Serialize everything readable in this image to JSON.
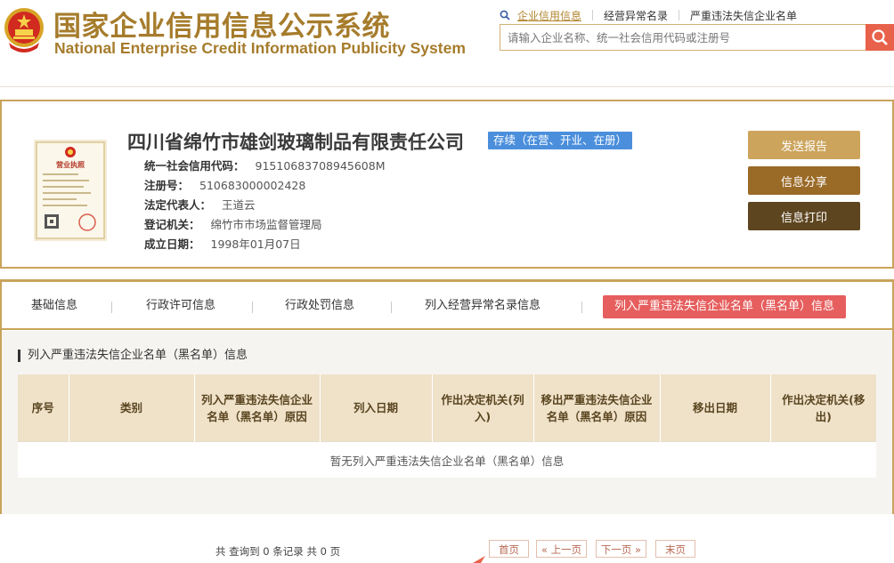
{
  "header": {
    "logo_cn": "国家企业信用信息公示系统",
    "logo_en": "National Enterprise Credit Information Publicity System",
    "emblem_icon": "national-emblem-icon",
    "nav": [
      {
        "label": "企业信用信息",
        "active": true
      },
      {
        "label": "经营异常名录",
        "active": false
      },
      {
        "label": "严重违法失信企业名单",
        "active": false
      }
    ],
    "search": {
      "placeholder": "请输入企业名称、统一社会信用代码或注册号",
      "value": "",
      "button_icon": "search-icon"
    }
  },
  "company": {
    "name": "四川省绵竹市雄剑玻璃制品有限责任公司",
    "status": "存续（在营、开业、在册）",
    "license_icon": "business-license-icon",
    "license_title": "营业执照",
    "fields": [
      {
        "key": "统一社会信用代码：",
        "value": "91510683708945608M"
      },
      {
        "key": "注册号：",
        "value": "510683000002428"
      },
      {
        "key": "法定代表人：",
        "value": "王道云"
      },
      {
        "key": "登记机关：",
        "value": "绵竹市市场监督管理局"
      },
      {
        "key": "成立日期：",
        "value": "1998年01月07日"
      }
    ],
    "actions": {
      "send_report": "发送报告",
      "share": "信息分享",
      "print": "信息打印"
    }
  },
  "tabs": [
    {
      "label": "基础信息",
      "active": false
    },
    {
      "label": "行政许可信息",
      "active": false
    },
    {
      "label": "行政处罚信息",
      "active": false
    },
    {
      "label": "列入经营异常名录信息",
      "active": false
    },
    {
      "label": "列入严重违法失信企业名单（黑名单）信息",
      "active": true
    }
  ],
  "blacklist": {
    "section_title": "列入严重违法失信企业名单（黑名单）信息",
    "columns": [
      "序号",
      "类别",
      "列入严重违法失信企业名单（黑名单）原因",
      "列入日期",
      "作出决定机关(列入)",
      "移出严重违法失信企业名单（黑名单）原因",
      "移出日期",
      "作出决定机关(移出)"
    ],
    "empty_message": "暂无列入严重违法失信企业名单（黑名单）信息",
    "pager": {
      "summary": "共 查询到 0 条记录 共 0 页",
      "first": "首页",
      "prev": "« 上一页",
      "next": "下一页 »",
      "last": "末页"
    }
  },
  "colors": {
    "gold": "#c9a35b",
    "title_gold": "#a67c2c",
    "status_blue": "#4b8fdc",
    "active_tab_red": "#e65e5e",
    "search_red": "#e8614b"
  }
}
